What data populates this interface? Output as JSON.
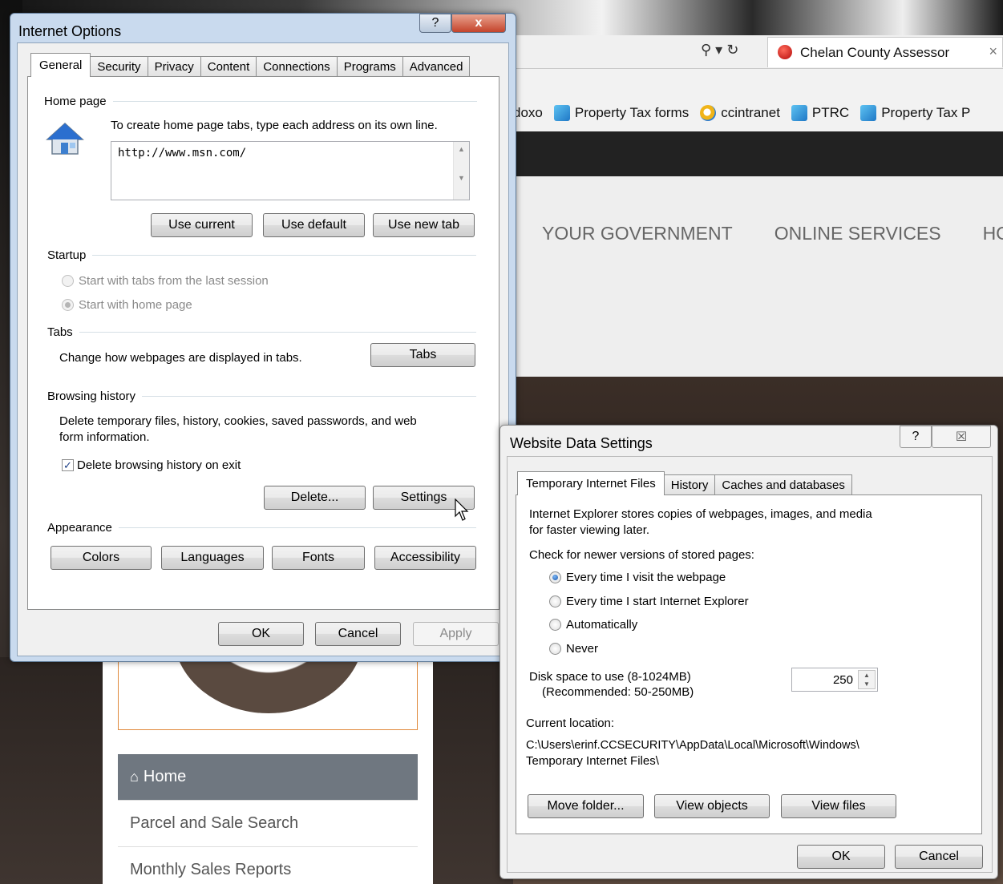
{
  "browser": {
    "tab_title": "Chelan County Assessor",
    "tab_close": "×",
    "controls": "⚲ ▾ ↻",
    "favorites": [
      {
        "label": "doxo",
        "icon": "doxo-icon"
      },
      {
        "label": "Property Tax forms",
        "icon": "link-icon"
      },
      {
        "label": "ccintranet",
        "icon": "ie-icon"
      },
      {
        "label": "PTRC",
        "icon": "link-icon"
      },
      {
        "label": "Property Tax P",
        "icon": "link-icon"
      }
    ],
    "nav": [
      "YOUR GOVERNMENT",
      "ONLINE SERVICES",
      "HO"
    ]
  },
  "site": {
    "side_nav": [
      "Home",
      "Parcel and Sale Search",
      "Monthly Sales Reports"
    ]
  },
  "internet_options": {
    "title": "Internet Options",
    "help_btn": "?",
    "close_btn": "x",
    "tabs": [
      "General",
      "Security",
      "Privacy",
      "Content",
      "Connections",
      "Programs",
      "Advanced"
    ],
    "home_page": {
      "heading": "Home page",
      "instruction": "To create home page tabs, type each address on its own line.",
      "url_value": "http://www.msn.com/",
      "use_current": "Use current",
      "use_default": "Use default",
      "use_new_tab": "Use new tab"
    },
    "startup": {
      "heading": "Startup",
      "option1": "Start with tabs from the last session",
      "option2": "Start with home page"
    },
    "tabs_section": {
      "heading": "Tabs",
      "desc": "Change how webpages are displayed in tabs.",
      "button": "Tabs"
    },
    "browsing_history": {
      "heading": "Browsing history",
      "desc_line1": "Delete temporary files, history, cookies, saved passwords, and web",
      "desc_line2": "form information.",
      "checkbox_label": "Delete browsing history on exit",
      "delete_btn": "Delete...",
      "settings_btn": "Settings"
    },
    "appearance": {
      "heading": "Appearance",
      "colors": "Colors",
      "languages": "Languages",
      "fonts": "Fonts",
      "accessibility": "Accessibility"
    },
    "ok": "OK",
    "cancel": "Cancel",
    "apply": "Apply"
  },
  "website_data": {
    "title": "Website Data Settings",
    "help_btn": "?",
    "close_btn": "☒",
    "tabs": [
      "Temporary Internet Files",
      "History",
      "Caches and databases"
    ],
    "desc_line1": "Internet Explorer stores copies of webpages, images, and media",
    "desc_line2": "for faster viewing later.",
    "check_label": "Check for newer versions of stored pages:",
    "options": [
      "Every time I visit the webpage",
      "Every time I start Internet Explorer",
      "Automatically",
      "Never"
    ],
    "disk_label_line1": "Disk space to use (8-1024MB)",
    "disk_label_line2": "(Recommended: 50-250MB)",
    "disk_value": "250",
    "current_location_label": "Current location:",
    "location_line1": "C:\\Users\\erinf.CCSECURITY\\AppData\\Local\\Microsoft\\Windows\\",
    "location_line2": "Temporary Internet Files\\",
    "move_folder": "Move folder...",
    "view_objects": "View objects",
    "view_files": "View files",
    "ok": "OK",
    "cancel": "Cancel"
  }
}
